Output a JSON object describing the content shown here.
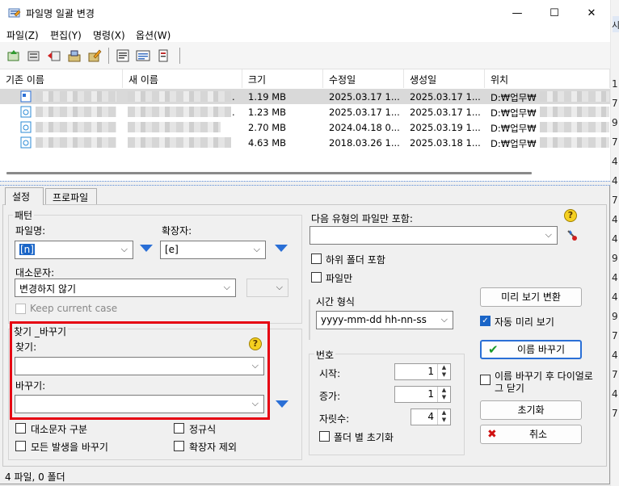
{
  "window": {
    "title": "파일명 일괄 변경",
    "minimize": "—",
    "maximize": "☐",
    "close": "✕"
  },
  "menu": [
    "파일(Z)",
    "편집(Y)",
    "명령(X)",
    "옵션(W)"
  ],
  "list": {
    "columns": [
      "기존 이름",
      "새 이름",
      "크기",
      "수정일",
      "생성일",
      "위치"
    ],
    "rows": [
      {
        "new_suffix": ".",
        "size": "1.19 MB",
        "modified": "2025.03.17 1...",
        "created": "2025.03.17 1...",
        "location": "D:₩업무₩"
      },
      {
        "new_suffix": ".",
        "size": "1.23 MB",
        "modified": "2025.03.17 1...",
        "created": "2025.03.17 1...",
        "location": "D:₩업무₩"
      },
      {
        "new_suffix": "",
        "size": "2.70 MB",
        "modified": "2024.04.18 0...",
        "created": "2025.03.19 1...",
        "location": "D:₩업무₩"
      },
      {
        "new_suffix": "",
        "size": "4.63 MB",
        "modified": "2018.03.26 1...",
        "created": "2025.03.18 1...",
        "location": "D:₩업무₩"
      }
    ]
  },
  "tabs": [
    "설정",
    "프로파일"
  ],
  "pattern": {
    "group": "패턴",
    "filename_label": "파일명:",
    "filename_value": "[n]",
    "ext_label": "확장자:",
    "ext_value": "[e]",
    "case_label": "대소문자:",
    "case_value": "변경하지 않기",
    "keep_case": "Keep current case"
  },
  "find_replace": {
    "group": "찾기 _바꾸기",
    "find_label": "찾기:",
    "replace_label": "바꾸기:",
    "match_case": "대소문자 구분",
    "regex": "정규식",
    "replace_all": "모든 발생을 바꾸기",
    "exclude_ext": "확장자 제외"
  },
  "filter": {
    "label": "다음 유형의 파일만 포함:",
    "subfolders": "하위 폴더 포함",
    "files_only": "파일만"
  },
  "time": {
    "group": "시간 형식",
    "value": "yyyy-mm-dd hh-nn-ss"
  },
  "number": {
    "group": "번호",
    "start_label": "시작:",
    "start": "1",
    "step_label": "증가:",
    "step": "1",
    "digits_label": "자릿수:",
    "digits": "4",
    "reset_folder": "폴더 별 초기화"
  },
  "actions": {
    "preview": "미리 보기 변환",
    "auto_preview": "자동 미리 보기",
    "rename": "이름 바꾸기",
    "close_after_1": "이름 바꾸기 후 다이얼로",
    "close_after_2": "그 닫기",
    "reset": "초기화",
    "cancel": "취소"
  },
  "status": "4 파일, 0 폴더",
  "right_edge": [
    "1:",
    "7:",
    "9:",
    "7:",
    "4:",
    "4:",
    "7:",
    "4:",
    "4:",
    "9:",
    "4:",
    "4:",
    "9:",
    "7:",
    "4:",
    "7:",
    "4:",
    "7:"
  ],
  "right_edge_top": "시"
}
